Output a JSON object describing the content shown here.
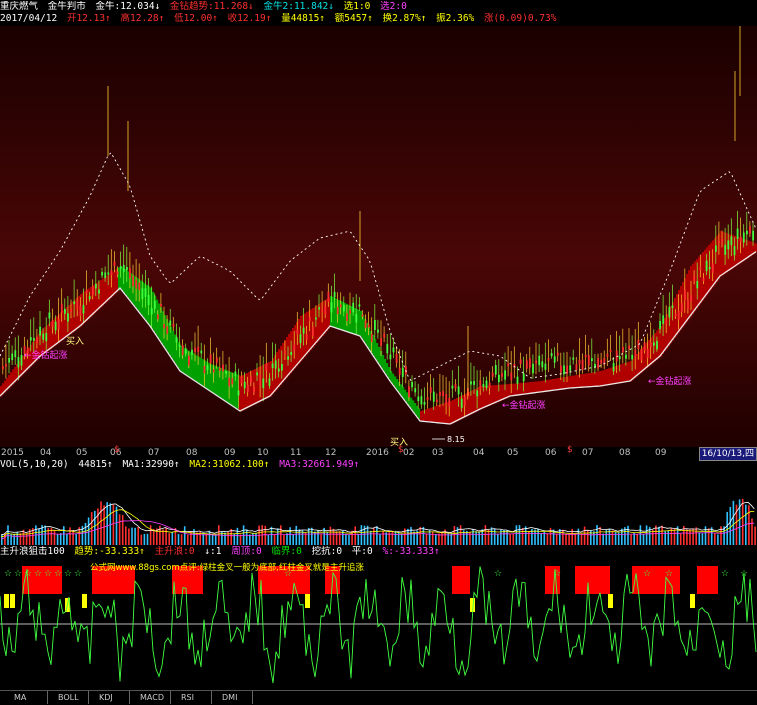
{
  "header": {
    "row1": {
      "stock": "重庆燃气",
      "indicator": "金牛判市",
      "gold1": "金牛:12.034↓",
      "trend": "金钻趋势:11.268↓",
      "gold2": "金牛2:11.842↓",
      "sel1": "选1:0",
      "sel2": "选2:0"
    },
    "row2": {
      "date": "2017/04/12",
      "open": "开12.13↑",
      "high": "高12.28↑",
      "low": "低12.00↑",
      "close": "收12.19↑",
      "volume": "量44815↑",
      "amount": "额5457↑",
      "turnover": "换2.87%↑",
      "amplitude": "振2.36%",
      "change": "涨(0.09)0.73%"
    }
  },
  "annotations": {
    "buy": "买入",
    "start": "←金钻起涨",
    "low_value": "8.15"
  },
  "date_axis": {
    "labels": [
      "2015",
      "04",
      "05",
      "06",
      "07",
      "08",
      "09",
      "10",
      "11",
      "12",
      "2016",
      "02",
      "03",
      "04",
      "05",
      "06",
      "07",
      "08",
      "09"
    ],
    "markers": [
      "$",
      "$",
      "$"
    ],
    "end_label": "16/10/13,四"
  },
  "volume": {
    "title": "VOL(5,10,20)",
    "volume": "44815↑",
    "ma1": "MA1:32990↑",
    "ma2": "MA2:31062.100↑",
    "ma3": "MA3:32661.949↑"
  },
  "indicator": {
    "name": "主升浪狙击100",
    "trend": "趋势:-33.333↑",
    "main_rise": "主升浪:0",
    "arrow": "↓:1",
    "top": "周顶:0",
    "boundary": "临界:0",
    "bottom": "挖抗:0",
    "flat": "平:0",
    "pct": "%:-33.333↑",
    "tip": "公式网www.88gs.com点评:绿柱金叉一般为底部,红柱金叉就是主升追涨"
  },
  "tabs": [
    "MA",
    "BOLL",
    "KDJ",
    "MACD",
    "RSI",
    "DMI"
  ],
  "colors": {
    "bg": "#000000",
    "main_bg_top": "#3a0000",
    "ribbon_red": "#b00000",
    "ribbon_green": "#00a000",
    "candle_up": "#ff3030",
    "candle_down": "#40ff40",
    "ma_white": "#e0e0e0",
    "dotted": "#ffffff",
    "vol_ma1": "#ffffff",
    "vol_ma2": "#ffff00",
    "vol_ma3": "#ff40ff",
    "ind_line": "#40ff40",
    "ind_red": "#ff0000",
    "ind_yellow": "#ffff00"
  }
}
